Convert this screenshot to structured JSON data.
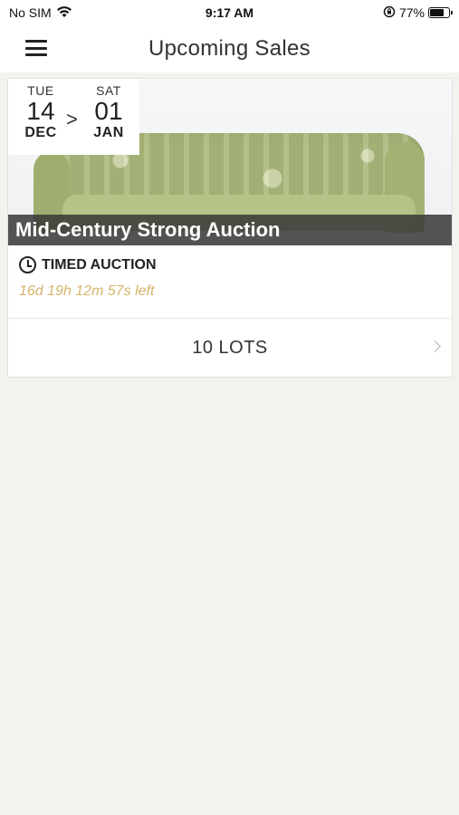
{
  "status_bar": {
    "carrier": "No SIM",
    "time": "9:17 AM",
    "battery": "77%",
    "battery_level": 0.77,
    "icons": [
      "wifi-icon",
      "orientation-lock-icon",
      "battery-icon"
    ]
  },
  "nav": {
    "title": "Upcoming Sales",
    "menu_icon": "hamburger-menu-icon"
  },
  "sale": {
    "start": {
      "weekday": "TUE",
      "day": "14",
      "month": "DEC"
    },
    "separator": ">",
    "end": {
      "weekday": "SAT",
      "day": "01",
      "month": "JAN"
    },
    "title": "Mid-Century Strong Auction",
    "type": "TIMED AUCTION",
    "countdown": "16d 19h 12m 57s left",
    "lots": "10 LOTS"
  },
  "colors": {
    "background": "#f3f2ef",
    "countdown": "#d4b46a",
    "title_band": "#373737"
  }
}
